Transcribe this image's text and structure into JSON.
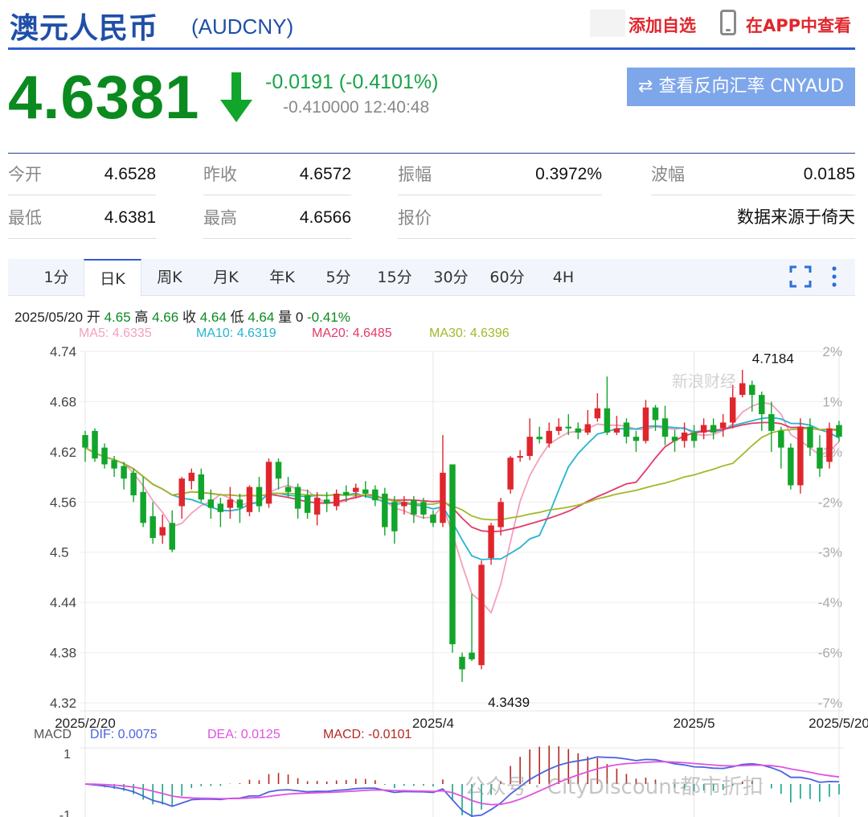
{
  "header": {
    "name": "澳元人民币",
    "code": "(AUDCNY)",
    "add_fav": "添加自选",
    "app_view": "在APP中查看"
  },
  "quote": {
    "price": "4.6381",
    "change": "-0.0191 (-0.4101%)",
    "change2": "-0.410000 12:40:48",
    "reverse_button": "查看反向汇率 CNYAUD",
    "direction": "down",
    "color_down": "#0b8a1f"
  },
  "stats": [
    {
      "label": "今开",
      "value": "4.6528"
    },
    {
      "label": "昨收",
      "value": "4.6572"
    },
    {
      "label": "振幅",
      "value": "0.3972%"
    },
    {
      "label": "波幅",
      "value": "0.0185"
    },
    {
      "label": "最低",
      "value": "4.6381"
    },
    {
      "label": "最高",
      "value": "4.6566"
    },
    {
      "label": "报价",
      "value": ""
    },
    {
      "label": "",
      "value": "数据来源于倚天"
    }
  ],
  "tabs": [
    "1分",
    "日K",
    "周K",
    "月K",
    "年K",
    "5分",
    "15分",
    "30分",
    "60分",
    "4H"
  ],
  "active_tab": "日K",
  "info": {
    "date": "2025/05/20",
    "open_label": "开",
    "open": "4.65",
    "high_label": "高",
    "high": "4.66",
    "close_label": "收",
    "close": "4.64",
    "low_label": "低",
    "low": "4.64",
    "vol_label": "量",
    "vol": "0",
    "pct": "-0.41%"
  },
  "ma": [
    {
      "text": "MA5: 4.6335",
      "color": "#f4a0bd"
    },
    {
      "text": "MA10: 4.6319",
      "color": "#26b4cf"
    },
    {
      "text": "MA20: 4.6485",
      "color": "#e23b6a"
    },
    {
      "text": "MA30: 4.6396",
      "color": "#9fba2a"
    }
  ],
  "macd_legend": [
    {
      "text": "MACD",
      "color": "#555"
    },
    {
      "text": "DIF: 0.0075",
      "color": "#4b63e0"
    },
    {
      "text": "DEA: 0.0125",
      "color": "#e052e0"
    },
    {
      "text": "MACD: -0.0101",
      "color": "#b2291f"
    }
  ],
  "watermarks": {
    "main": "公众号 · CityDiscount都市折扣",
    "sina": "新浪财经"
  },
  "chart_data": {
    "type": "candlestick",
    "title": "",
    "y_ticks": [
      "4.74",
      "4.68",
      "4.62",
      "4.56",
      "4.5",
      "4.44",
      "4.38",
      "4.32"
    ],
    "y_tick_values": [
      4.74,
      4.68,
      4.62,
      4.56,
      4.5,
      4.44,
      4.38,
      4.32
    ],
    "pct_ticks": [
      "2%",
      "1%",
      "-1%",
      "-2%",
      "-3%",
      "-4%",
      "-6%",
      "-7%"
    ],
    "pct_tick_values": [
      4.74,
      4.68,
      4.62,
      4.56,
      4.5,
      4.44,
      4.38,
      4.32
    ],
    "x_labels": [
      {
        "label": "2025/2/20",
        "index": 0
      },
      {
        "label": "2025/4",
        "index": 36
      },
      {
        "label": "2025/5",
        "index": 63
      },
      {
        "label": "2025/5/20",
        "index": 78
      }
    ],
    "ylim": [
      4.32,
      4.74
    ],
    "annotations": [
      {
        "text": "4.7184",
        "index": 70,
        "value": 4.7184,
        "pos": "above"
      },
      {
        "text": "4.3439",
        "index": 43,
        "value": 4.3439,
        "pos": "below"
      }
    ],
    "up_color": "#e0262d",
    "down_color": "#12a52b",
    "candles": [
      [
        4.64,
        4.625,
        4.645,
        4.608
      ],
      [
        4.645,
        4.612,
        4.648,
        4.608
      ],
      [
        4.625,
        4.605,
        4.63,
        4.6
      ],
      [
        4.61,
        4.6,
        4.615,
        4.59
      ],
      [
        4.603,
        4.588,
        4.608,
        4.575
      ],
      [
        4.595,
        4.568,
        4.6,
        4.56
      ],
      [
        4.572,
        4.535,
        4.59,
        4.53
      ],
      [
        4.543,
        4.517,
        4.56,
        4.51
      ],
      [
        4.52,
        4.53,
        4.545,
        4.51
      ],
      [
        4.535,
        4.503,
        4.55,
        4.5
      ],
      [
        4.555,
        4.588,
        4.59,
        4.54
      ],
      [
        4.585,
        4.595,
        4.6,
        4.575
      ],
      [
        4.593,
        4.563,
        4.6,
        4.56
      ],
      [
        4.563,
        4.553,
        4.575,
        4.54
      ],
      [
        4.558,
        4.548,
        4.565,
        4.53
      ],
      [
        4.553,
        4.563,
        4.578,
        4.54
      ],
      [
        4.563,
        4.553,
        4.57,
        4.535
      ],
      [
        4.548,
        4.578,
        4.58,
        4.543
      ],
      [
        4.578,
        4.555,
        4.59,
        4.548
      ],
      [
        4.558,
        4.608,
        4.612,
        4.553
      ],
      [
        4.608,
        4.588,
        4.612,
        4.575
      ],
      [
        4.578,
        4.572,
        4.59,
        4.565
      ],
      [
        4.578,
        4.552,
        4.582,
        4.54
      ],
      [
        4.568,
        4.547,
        4.575,
        4.54
      ],
      [
        4.545,
        4.565,
        4.572,
        4.532
      ],
      [
        4.563,
        4.558,
        4.572,
        4.548
      ],
      [
        4.555,
        4.57,
        4.575,
        4.55
      ],
      [
        4.572,
        4.568,
        4.58,
        4.56
      ],
      [
        4.572,
        4.577,
        4.582,
        4.565
      ],
      [
        4.575,
        4.57,
        4.585,
        4.565
      ],
      [
        4.575,
        4.562,
        4.58,
        4.555
      ],
      [
        4.57,
        4.53,
        4.577,
        4.52
      ],
      [
        4.56,
        4.525,
        4.567,
        4.51
      ],
      [
        4.555,
        4.56,
        4.567,
        4.545
      ],
      [
        4.562,
        4.545,
        4.567,
        4.535
      ],
      [
        4.56,
        4.545,
        4.565,
        4.54
      ],
      [
        4.545,
        4.535,
        4.55,
        4.53
      ],
      [
        4.535,
        4.595,
        4.64,
        4.53
      ],
      [
        4.605,
        4.39,
        4.605,
        4.38
      ],
      [
        4.375,
        4.36,
        4.38,
        4.345
      ],
      [
        4.38,
        4.372,
        4.45,
        4.37
      ],
      [
        4.365,
        4.485,
        4.49,
        4.36
      ],
      [
        4.493,
        4.532,
        4.535,
        4.485
      ],
      [
        4.53,
        4.56,
        4.565,
        4.52
      ],
      [
        4.575,
        4.613,
        4.615,
        4.57
      ],
      [
        4.613,
        4.615,
        4.622,
        4.608
      ],
      [
        4.615,
        4.638,
        4.66,
        4.61
      ],
      [
        4.638,
        4.635,
        4.65,
        4.63
      ],
      [
        4.63,
        4.645,
        4.655,
        4.625
      ],
      [
        4.645,
        4.65,
        4.66,
        4.64
      ],
      [
        4.65,
        4.648,
        4.665,
        4.64
      ],
      [
        4.648,
        4.643,
        4.655,
        4.635
      ],
      [
        4.643,
        4.653,
        4.67,
        4.64
      ],
      [
        4.66,
        4.672,
        4.69,
        4.656
      ],
      [
        4.672,
        4.643,
        4.71,
        4.64
      ],
      [
        4.643,
        4.648,
        4.663,
        4.64
      ],
      [
        4.655,
        4.638,
        4.66,
        4.63
      ],
      [
        4.638,
        4.633,
        4.645,
        4.62
      ],
      [
        4.633,
        4.673,
        4.682,
        4.63
      ],
      [
        4.673,
        4.658,
        4.676,
        4.645
      ],
      [
        4.66,
        4.638,
        4.675,
        4.628
      ],
      [
        4.638,
        4.633,
        4.646,
        4.62
      ],
      [
        4.633,
        4.643,
        4.655,
        4.625
      ],
      [
        4.643,
        4.633,
        4.652,
        4.625
      ],
      [
        4.643,
        4.652,
        4.66,
        4.635
      ],
      [
        4.652,
        4.643,
        4.66,
        4.635
      ],
      [
        4.648,
        4.655,
        4.665,
        4.638
      ],
      [
        4.655,
        4.685,
        4.7,
        4.648
      ],
      [
        4.688,
        4.702,
        4.718,
        4.685
      ],
      [
        4.7,
        4.688,
        4.705,
        4.668
      ],
      [
        4.688,
        4.665,
        4.692,
        4.645
      ],
      [
        4.665,
        4.645,
        4.68,
        4.62
      ],
      [
        4.645,
        4.625,
        4.65,
        4.6
      ],
      [
        4.625,
        4.58,
        4.63,
        4.575
      ],
      [
        4.58,
        4.65,
        4.66,
        4.57
      ],
      [
        4.65,
        4.625,
        4.66,
        4.615
      ],
      [
        4.625,
        4.6,
        4.64,
        4.59
      ],
      [
        4.608,
        4.648,
        4.655,
        4.6
      ],
      [
        4.652,
        4.638,
        4.657,
        4.632
      ]
    ],
    "macd": {
      "ylim": [
        -1,
        1
      ],
      "y_ticks": [
        "1",
        "-1"
      ],
      "y_tick_values": [
        1,
        -1
      ]
    }
  }
}
